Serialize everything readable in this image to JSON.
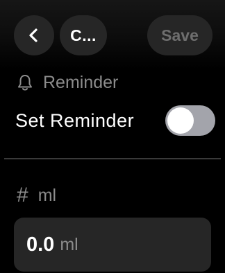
{
  "header": {
    "back_icon": "chevron-left-icon",
    "title": "C...",
    "save_label": "Save"
  },
  "reminder": {
    "section_icon": "bell-icon",
    "section_label": "Reminder",
    "toggle_label": "Set Reminder",
    "toggle_on": false
  },
  "quantity": {
    "unit_icon": "hash-icon",
    "unit_icon_glyph": "#",
    "unit_label": "ml",
    "value": "0.0",
    "value_unit": "ml"
  },
  "colors": {
    "background": "#000000",
    "control_fill": "#262626",
    "secondary_text": "#8c8c8c",
    "toggle_off": "#a3a4ab"
  }
}
